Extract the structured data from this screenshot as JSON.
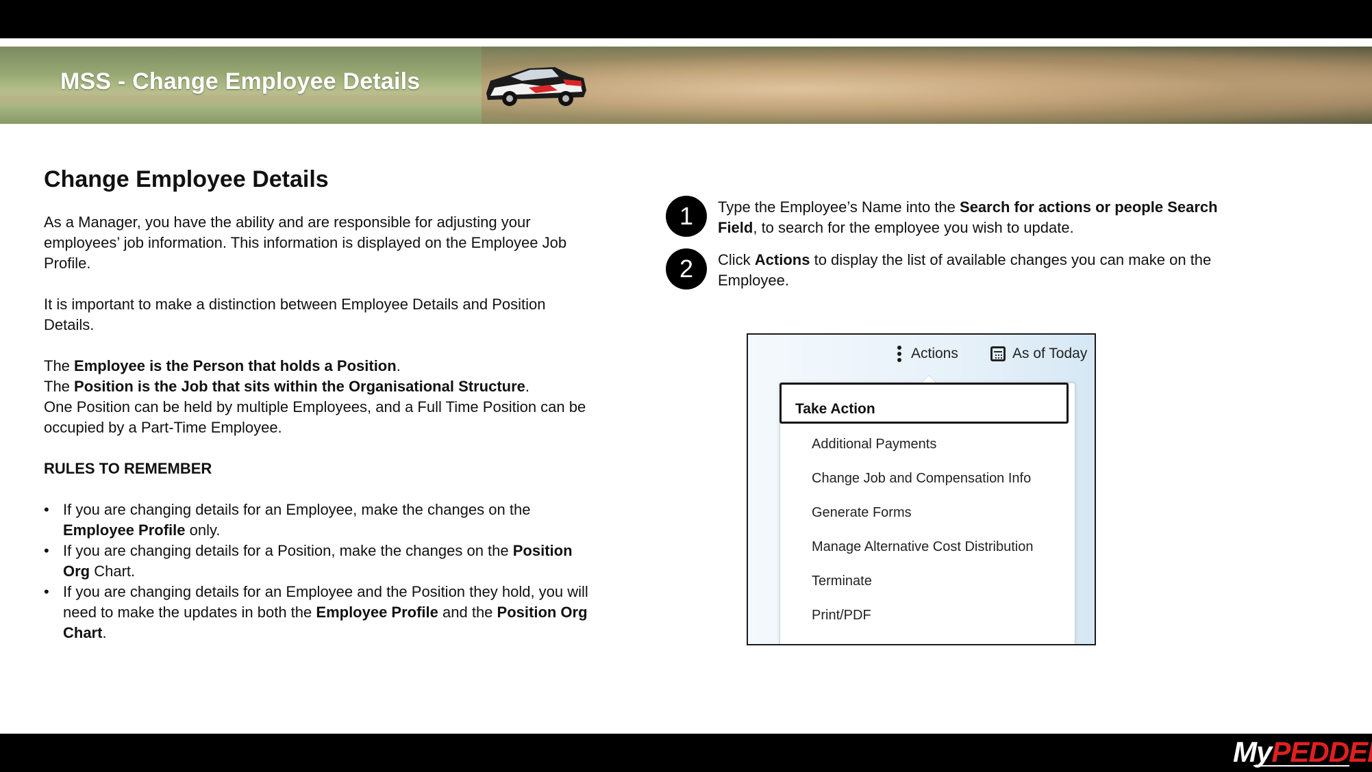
{
  "header": {
    "title": "MSS - Change Employee Details"
  },
  "intro": {
    "heading": "Change Employee Details",
    "para1": "As a Manager, you have the ability and are responsible for adjusting your employees’ job information. This information is displayed on the Employee Job Profile.",
    "para2": "It is important to make a distinction between Employee Details and Position Details.",
    "line_employee_prefix": "The ",
    "line_employee_bold": "Employee is the Person that holds a Position",
    "line_employee_suffix": ".",
    "line_position_prefix": "The ",
    "line_position_bold": "Position is the Job that sits within the Organisational Structure",
    "line_position_suffix": ".",
    "para3": "One Position can be held by multiple Employees, and a Full Time Position can be occupied by a Part-Time Employee.",
    "rules_heading": "RULES TO REMEMBER",
    "bullets": [
      {
        "a": "If you are changing details for an Employee, make the changes on the ",
        "b": "Employee Profile",
        "c": " only."
      },
      {
        "a": "If you are changing details for a Position, make the changes on the ",
        "b": "Position Org",
        "c": " Chart."
      },
      {
        "a": "If you are changing details for an Employee and the Position they hold, you will need to make the updates in both the ",
        "b": "Employee Profile",
        "c": " and the ",
        "d": "Position Org Chart",
        "e": "."
      }
    ]
  },
  "steps": [
    {
      "num": "1",
      "a": "Type the Employee’s Name into the ",
      "b": "Search for actions or people Search Field",
      "c": ", to search for the employee you wish to update."
    },
    {
      "num": "2",
      "a": "Click ",
      "b": "Actions",
      "c": " to display the list of available changes you can make on the Employee."
    }
  ],
  "screenshot": {
    "actions_label": "Actions",
    "asof_label": "As of Today",
    "menu_title": "Take Action",
    "menu_items": [
      "Additional Payments",
      "Change Job and Compensation Info",
      "Generate Forms",
      "Manage Alternative Cost Distribution",
      "Terminate",
      "Print/PDF"
    ]
  },
  "footer": {
    "logo_my": "My",
    "logo_pedders": "PEDDERS"
  },
  "icons": {
    "more": "kebab-vertical-icon",
    "calendar": "calendar-icon",
    "car": "rally-car-image"
  }
}
